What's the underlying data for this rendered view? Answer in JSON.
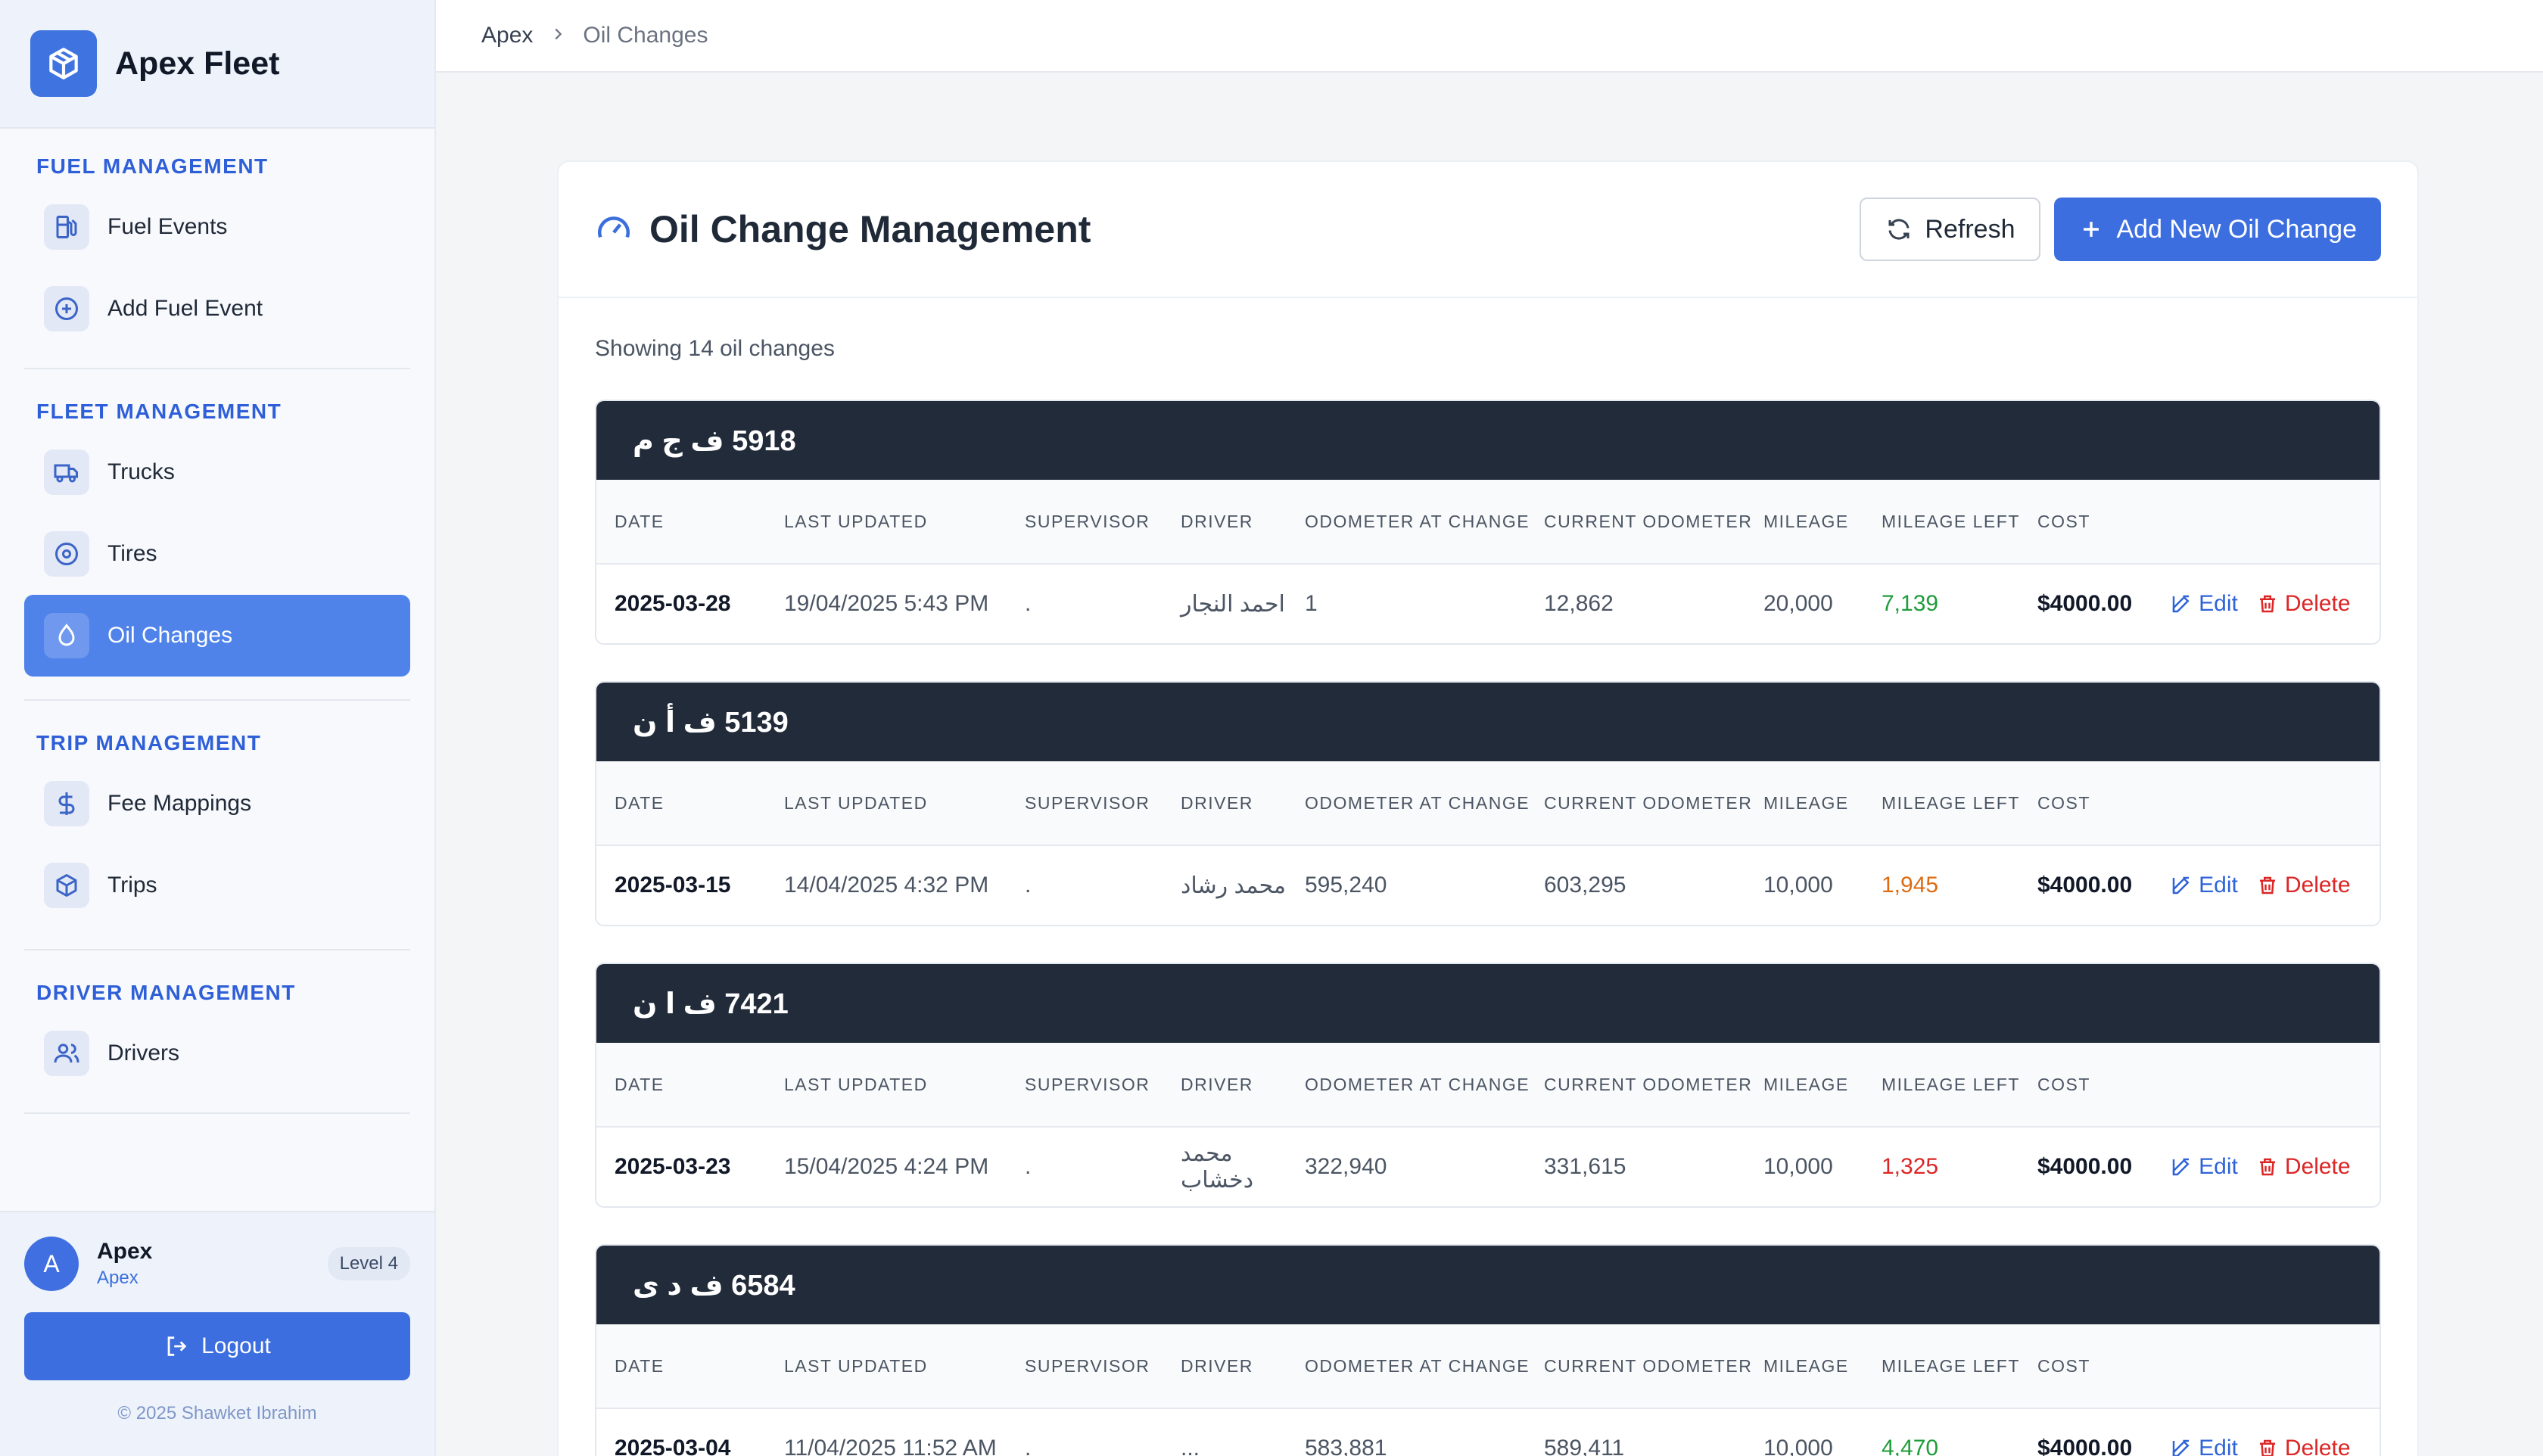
{
  "sidebar": {
    "brand": "Apex Fleet",
    "sections": [
      {
        "title": "FUEL MANAGEMENT",
        "items": [
          {
            "label": "Fuel Events",
            "icon": "fuel-pump-icon"
          },
          {
            "label": "Add Fuel Event",
            "icon": "plus-circle-icon"
          }
        ]
      },
      {
        "title": "FLEET MANAGEMENT",
        "items": [
          {
            "label": "Trucks",
            "icon": "truck-icon"
          },
          {
            "label": "Tires",
            "icon": "tire-icon"
          },
          {
            "label": "Oil Changes",
            "icon": "droplet-icon",
            "active": true
          }
        ]
      },
      {
        "title": "TRIP MANAGEMENT",
        "items": [
          {
            "label": "Fee Mappings",
            "icon": "dollar-icon"
          },
          {
            "label": "Trips",
            "icon": "box-icon"
          }
        ]
      },
      {
        "title": "DRIVER MANAGEMENT",
        "items": [
          {
            "label": "Drivers",
            "icon": "users-icon"
          }
        ]
      }
    ],
    "user": {
      "initial": "A",
      "name": "Apex",
      "sub": "Apex",
      "level": "Level 4"
    },
    "logout_label": "Logout",
    "copyright": "© 2025 Shawket Ibrahim"
  },
  "breadcrumb": {
    "root": "Apex",
    "current": "Oil Changes"
  },
  "page": {
    "title": "Oil Change Management",
    "refresh_label": "Refresh",
    "add_label": "Add New Oil Change",
    "showing": "Showing 14 oil changes"
  },
  "columns": [
    "DATE",
    "LAST UPDATED",
    "SUPERVISOR",
    "DRIVER",
    "ODOMETER AT CHANGE",
    "CURRENT ODOMETER",
    "MILEAGE",
    "MILEAGE LEFT",
    "COST"
  ],
  "actions": {
    "edit": "Edit",
    "delete": "Delete"
  },
  "groups": [
    {
      "truck": "5918 ف ج م",
      "row": {
        "date": "2025-03-28",
        "last_updated": "19/04/2025 5:43 PM",
        "supervisor": ".",
        "driver": "احمد النجار",
        "odometer_at_change": "1",
        "current_odometer": "12,862",
        "mileage": "20,000",
        "mileage_left": "7,139",
        "mileage_left_status": "green",
        "cost": "$4000.00"
      }
    },
    {
      "truck": "5139 ف أ ن",
      "row": {
        "date": "2025-03-15",
        "last_updated": "14/04/2025 4:32 PM",
        "supervisor": ".",
        "driver": "محمد رشاد",
        "odometer_at_change": "595,240",
        "current_odometer": "603,295",
        "mileage": "10,000",
        "mileage_left": "1,945",
        "mileage_left_status": "orange",
        "cost": "$4000.00"
      }
    },
    {
      "truck": "7421 ف ا ن",
      "row": {
        "date": "2025-03-23",
        "last_updated": "15/04/2025 4:24 PM",
        "supervisor": ".",
        "driver": "محمد دخشاب",
        "odometer_at_change": "322,940",
        "current_odometer": "331,615",
        "mileage": "10,000",
        "mileage_left": "1,325",
        "mileage_left_status": "red",
        "cost": "$4000.00"
      }
    },
    {
      "truck": "6584 ف د ى",
      "row": {
        "date": "2025-03-04",
        "last_updated": "11/04/2025 11:52 AM",
        "supervisor": ".",
        "driver": "...",
        "odometer_at_change": "583,881",
        "current_odometer": "589,411",
        "mileage": "10,000",
        "mileage_left": "4,470",
        "mileage_left_status": "green",
        "cost": "$4000.00"
      }
    }
  ],
  "colors": {
    "accent": "#3c6ee0",
    "active_nav": "#4f83ea",
    "group_header": "#222b3a"
  }
}
